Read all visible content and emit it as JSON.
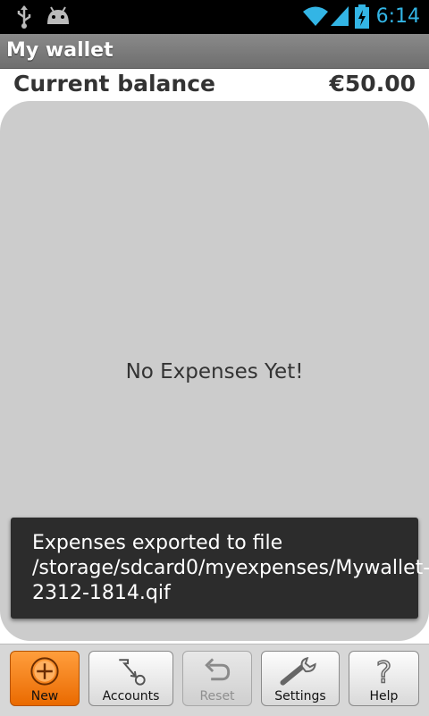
{
  "status_bar": {
    "time": "6:14",
    "icons": [
      "usb-icon",
      "android-icon",
      "wifi-icon",
      "signal-icon",
      "battery-charging-icon"
    ],
    "accent_color": "#33b5e5"
  },
  "app": {
    "title": "My wallet"
  },
  "balance": {
    "label": "Current balance",
    "amount": "€50.00"
  },
  "list": {
    "empty_text": "No Expenses Yet!"
  },
  "toast": {
    "message": "Expenses exported to file /storage/sdcard0/myexpenses/Mywallet-2312-1814.qif"
  },
  "toolbar": {
    "new_label": "New",
    "accounts_label": "Accounts",
    "reset_label": "Reset",
    "settings_label": "Settings",
    "help_label": "Help"
  },
  "colors": {
    "new_button": "#f07a10",
    "panel": "#cccccc",
    "toast_bg": "#2c2c2c"
  }
}
